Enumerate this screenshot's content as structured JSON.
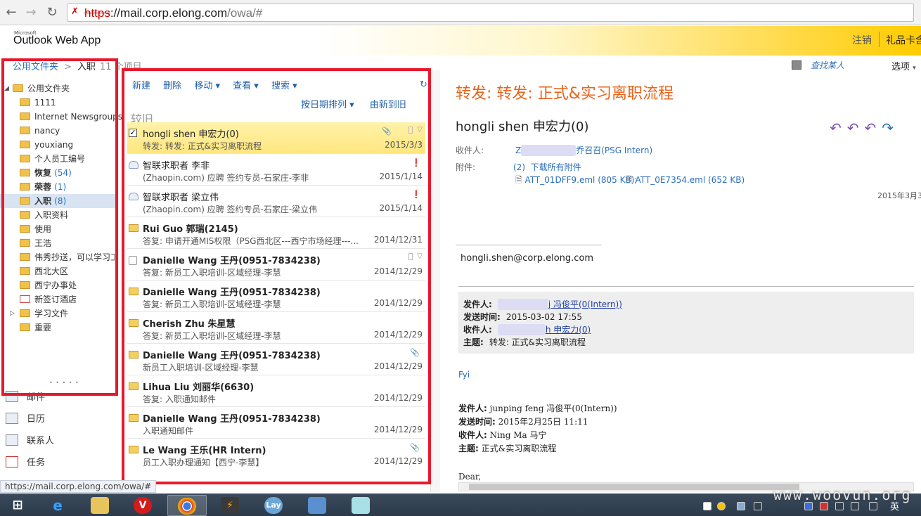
{
  "browser": {
    "url_scheme": "https",
    "url_host": "://mail.corp.elong.com",
    "url_path": "/owa/#"
  },
  "header": {
    "logo_small": "Microsoft",
    "logo_main": "Outlook Web App",
    "signout": "注销",
    "user": "礼品卡含"
  },
  "breadcrumb": {
    "root": "公用文件夹",
    "sep": ">",
    "current": "入职",
    "count": "11 个项目",
    "find_contacts": "查找某人",
    "options": "选项"
  },
  "folders": [
    {
      "label": "公用文件夹",
      "count": ""
    },
    {
      "label": "1111",
      "count": ""
    },
    {
      "label": "Internet Newsgroups",
      "count": ""
    },
    {
      "label": "nancy",
      "count": ""
    },
    {
      "label": "youxiang",
      "count": ""
    },
    {
      "label": "个人员工编号",
      "count": ""
    },
    {
      "label": "恢复",
      "count": "(54)"
    },
    {
      "label": "荣蓉",
      "count": "(1)"
    },
    {
      "label": "入职",
      "count": "(8)"
    },
    {
      "label": "入职资料",
      "count": ""
    },
    {
      "label": "使用",
      "count": ""
    },
    {
      "label": "王浩",
      "count": ""
    },
    {
      "label": "伟秀抄送，可以学习工作",
      "count": ""
    },
    {
      "label": "西北大区",
      "count": ""
    },
    {
      "label": "西宁办事处",
      "count": ""
    },
    {
      "label": "新签订酒店",
      "count": ""
    },
    {
      "label": "学习文件",
      "count": ""
    },
    {
      "label": "重要",
      "count": ""
    }
  ],
  "nav": {
    "dots": "• • • • •",
    "mail": "邮件",
    "calendar": "日历",
    "contacts": "联系人",
    "tasks": "任务"
  },
  "toolbar": {
    "new": "新建",
    "delete": "删除",
    "move": "移动 ▾",
    "view": "查看 ▾",
    "search": "搜索 ▾"
  },
  "sort": {
    "by_date": "按日期排列 ▾",
    "order": "由新到旧"
  },
  "group_label": "较旧",
  "messages": [
    {
      "sender": "hongli shen 申宏力(0)",
      "subject": "转发: 转发: 正式&实习离职流程",
      "date": "2015/3/3"
    },
    {
      "sender": "智联求职者 李非",
      "subject": "(Zhaopin.com) 应聘 签约专员-石家庄-李非",
      "date": "2015/1/14"
    },
    {
      "sender": "智联求职者 梁立伟",
      "subject": "(Zhaopin.com) 应聘 签约专员-石家庄-梁立伟",
      "date": "2015/1/14"
    },
    {
      "sender": "Rui Guo 郭瑞(2145)",
      "subject": "答复: 申请开通MIS权限（PSG西北区---西宁市场经理---...",
      "date": "2014/12/31"
    },
    {
      "sender": "Danielle Wang 王丹(0951-7834238)",
      "subject": "答复: 新员工入职培训-区域经理-李慧",
      "date": "2014/12/29"
    },
    {
      "sender": "Danielle Wang 王丹(0951-7834238)",
      "subject": "答复: 新员工入职培训-区域经理-李慧",
      "date": "2014/12/29"
    },
    {
      "sender": "Cherish Zhu 朱星慧",
      "subject": "答复: 新员工入职培训-区域经理-李慧",
      "date": "2014/12/29"
    },
    {
      "sender": "Danielle Wang 王丹(0951-7834238)",
      "subject": "新员工入职培训-区域经理-李慧",
      "date": "2014/12/29"
    },
    {
      "sender": "Lihua Liu 刘丽华(6630)",
      "subject": "答复: 入职通知邮件",
      "date": "2014/12/29"
    },
    {
      "sender": "Danielle Wang 王丹(0951-7834238)",
      "subject": "入职通知邮件",
      "date": "2014/12/29"
    },
    {
      "sender": "Le Wang 王乐(HR Intern)",
      "subject": "员工入职办理通知【西宁-李慧】",
      "date": "2014/12/29"
    }
  ],
  "reading": {
    "subject": "转发: 转发: 正式&实习离职流程",
    "from": "hongli shen 申宏力(0)",
    "to_label": "收件人:",
    "to_prefix": "Z",
    "to_value": "乔召召(PSG Intern)",
    "attach_label": "附件:",
    "attach_count": "(2)",
    "attach_download": "下载所有附件",
    "attach_1": "ATT_01DFF9.eml (805 KB);",
    "attach_2": "ATT_0E7354.eml (652 KB)",
    "date": "2015年3月3",
    "email": "hongli.shen@corp.elong.com",
    "fwd": {
      "from_label": "发件人:",
      "from_value": "j 冯俊平(0(Intern))",
      "sent_label": "发送时间:",
      "sent_value": "2015-03-02 17:55",
      "to_label": "收件人:",
      "to_value": "h 申宏力(0)",
      "subject_label": "主题:",
      "subject_value": "转发: 正式&实习离职流程"
    },
    "fyi": "Fyi",
    "orig": {
      "from_label": "发件人:",
      "from_value": "junping feng 冯俊平(0(Intern))",
      "sent_label": "发送时间:",
      "sent_value": "2015年2月25日 11:11",
      "to_label": "收件人:",
      "to_value": "Ning Ma 马宁",
      "subject_label": "主题:",
      "subject_value": "正式&实习离职流程"
    },
    "dear": "Dear,"
  },
  "status": "https://mail.corp.elong.com/owa/#",
  "taskbar": {
    "v_label": "V",
    "lay_label": "Lay",
    "lang": "英",
    "watermark": "www.woovun.org"
  }
}
